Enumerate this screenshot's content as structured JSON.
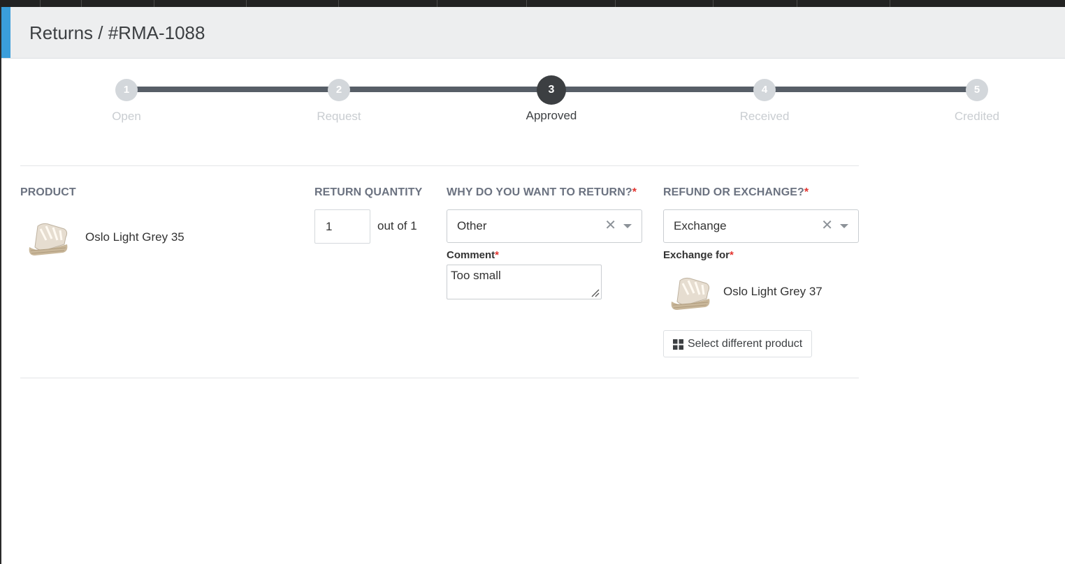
{
  "page": {
    "title": "Returns / #RMA-1088"
  },
  "stepper": {
    "current": 3,
    "steps": [
      {
        "number": "1",
        "label": "Open"
      },
      {
        "number": "2",
        "label": "Request"
      },
      {
        "number": "3",
        "label": "Approved"
      },
      {
        "number": "4",
        "label": "Received"
      },
      {
        "number": "5",
        "label": "Credited"
      }
    ]
  },
  "columns": {
    "product": "PRODUCT",
    "quantity": "RETURN QUANTITY",
    "reason": "WHY DO YOU WANT TO RETURN?",
    "resolution": "REFUND OR EXCHANGE?",
    "required_mark": "*"
  },
  "item": {
    "product_name": "Oslo Light Grey 35",
    "product_image": "wedge-sandal-image",
    "quantity": "1",
    "quantity_suffix": "out of 1",
    "reason": {
      "value": "Other",
      "clear_icon": "clear-icon",
      "dropdown_icon": "chevron-down-icon"
    },
    "comment": {
      "label": "Comment",
      "value": "Too small"
    },
    "resolution": {
      "value": "Exchange",
      "clear_icon": "clear-icon",
      "dropdown_icon": "chevron-down-icon"
    },
    "exchange": {
      "label": "Exchange for",
      "product_name": "Oslo Light Grey 37",
      "product_image": "wedge-sandal-image",
      "button_label": "Select different product",
      "button_icon": "grid-icon"
    }
  },
  "colors": {
    "accent": "#3a9edb",
    "track": "#575e67",
    "active_step": "#3c3f42",
    "inactive_step": "#d3d7db",
    "required": "#e3342f",
    "heading": "#6b7280"
  }
}
